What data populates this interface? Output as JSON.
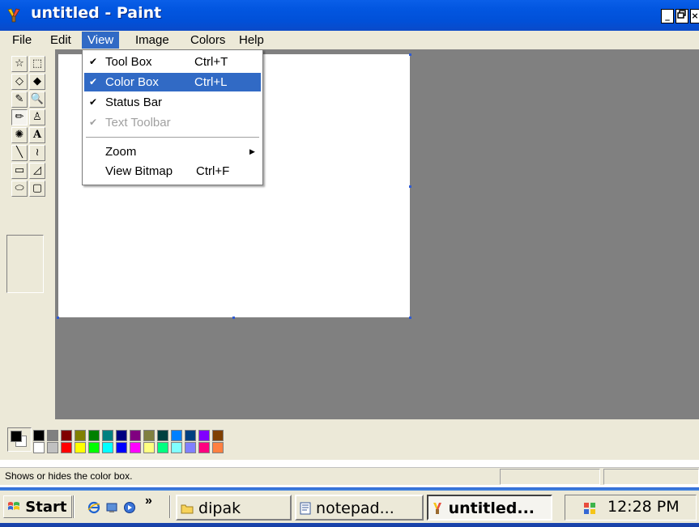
{
  "window": {
    "title": "untitled - Paint",
    "buttons": {
      "minimize": "_",
      "restore": "▫",
      "close": "×"
    }
  },
  "menubar": {
    "items": [
      "File",
      "Edit",
      "View",
      "Image",
      "Colors",
      "Help"
    ],
    "active": "View"
  },
  "view_menu": {
    "items": [
      {
        "label": "Tool Box",
        "shortcut": "Ctrl+T",
        "checked": true,
        "enabled": true
      },
      {
        "label": "Color Box",
        "shortcut": "Ctrl+L",
        "checked": true,
        "enabled": true,
        "highlighted": true
      },
      {
        "label": "Status Bar",
        "shortcut": "",
        "checked": true,
        "enabled": true
      },
      {
        "label": "Text Toolbar",
        "shortcut": "",
        "checked": true,
        "enabled": false
      },
      {
        "label": "Zoom",
        "shortcut": "",
        "checked": false,
        "enabled": true,
        "submenu": true
      },
      {
        "label": "View Bitmap",
        "shortcut": "Ctrl+F",
        "checked": false,
        "enabled": true
      }
    ],
    "check_glyph": "✔",
    "submenu_glyph": "▶"
  },
  "toolbox": {
    "tools": [
      "free-form-select",
      "select",
      "eraser",
      "fill-with-color",
      "pick-color",
      "magnifier",
      "pencil",
      "brush",
      "airbrush",
      "text",
      "line",
      "curve",
      "rectangle",
      "polygon",
      "ellipse",
      "rounded-rectangle"
    ],
    "selected": "pencil",
    "glyphs": [
      "☆",
      "⬚",
      "◇",
      "◆",
      "✎",
      "🔍",
      "✏",
      "♙",
      "✺",
      "A",
      "╲",
      "≀",
      "▭",
      "◿",
      "⬭",
      "▢"
    ]
  },
  "palette": {
    "foreground": "#000000",
    "background": "#ffffff",
    "row1": [
      "#000000",
      "#808080",
      "#800000",
      "#808000",
      "#008000",
      "#008080",
      "#000080",
      "#800080",
      "#808040",
      "#004040",
      "#0080ff",
      "#004080",
      "#8000ff",
      "#804000"
    ],
    "row2": [
      "#ffffff",
      "#c0c0c0",
      "#ff0000",
      "#ffff00",
      "#00ff00",
      "#00ffff",
      "#0000ff",
      "#ff00ff",
      "#ffff80",
      "#00ff80",
      "#80ffff",
      "#8080ff",
      "#ff0080",
      "#ff8040"
    ]
  },
  "statusbar": {
    "text": "Shows or hides the color box."
  },
  "taskbar": {
    "start_label": "Start",
    "more_glyph": "»",
    "tasks": [
      {
        "label": "dipak",
        "icon": "folder-icon",
        "pressed": false
      },
      {
        "label": "notepad...",
        "icon": "document-icon",
        "pressed": false
      },
      {
        "label": "untitled...",
        "icon": "paint-icon",
        "pressed": true
      }
    ],
    "clock": "12:28 PM"
  },
  "colors": {
    "titlebar": "#0553e0",
    "menu_highlight": "#316ac5",
    "workspace": "#808080",
    "chrome": "#ece9d8"
  }
}
